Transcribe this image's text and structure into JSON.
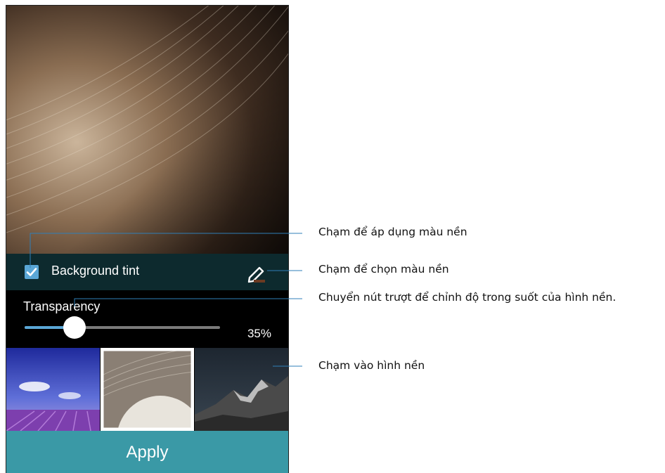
{
  "settings": {
    "background_tint_label": "Background tint",
    "background_tint_checked": true,
    "transparency_label": "Transparency",
    "transparency_value_text": "35%",
    "transparency_value": 0.35,
    "apply_label": "Apply"
  },
  "wallpapers": [
    {
      "name": "lavender-field",
      "selected": false
    },
    {
      "name": "vinyl-record",
      "selected": true
    },
    {
      "name": "mountain-peak",
      "selected": false
    }
  ],
  "callouts": {
    "apply_tint": "Chạm để áp dụng màu nền",
    "choose_color": "Chạm để chọn màu nền",
    "slider_hint": "Chuyển nút trượt để chỉnh độ trong suốt của hình nền.",
    "tap_wallpaper": "Chạm vào hình nền"
  },
  "colors": {
    "accent": "#5aa7d6",
    "apply_button": "#3a99a6",
    "tint_row_bg": "#0d2a2e"
  },
  "icons": {
    "checkbox": "checkmark-icon",
    "edit": "pencil-icon"
  }
}
